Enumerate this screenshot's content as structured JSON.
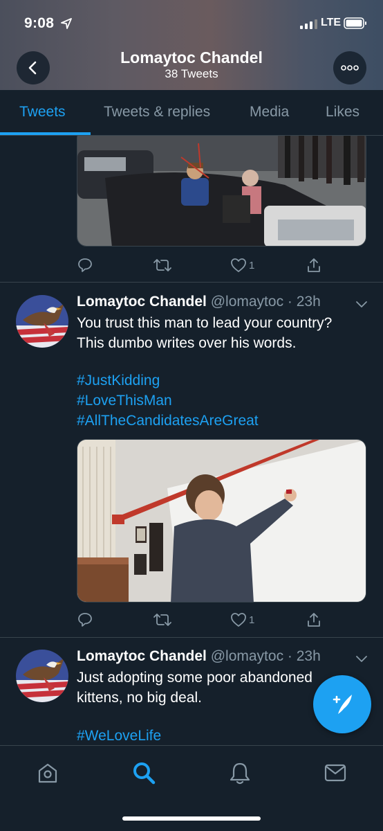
{
  "status_bar": {
    "time": "9:08",
    "network": "LTE"
  },
  "header": {
    "name": "Lomaytoc Chandel",
    "tweet_count": "38 Tweets"
  },
  "tabs": [
    {
      "label": "Tweets",
      "active": true
    },
    {
      "label": "Tweets & replies",
      "active": false
    },
    {
      "label": "Media",
      "active": false
    },
    {
      "label": "Likes",
      "active": false
    }
  ],
  "tweets": [
    {
      "partial": true,
      "image": "motorcade-photo",
      "likes": "1"
    },
    {
      "name": "Lomaytoc Chandel",
      "handle": "@lomaytoc",
      "time": "· 23h",
      "text_lines": [
        "You trust this man to lead your country?",
        "This dumbo writes over his words."
      ],
      "hashtags": [
        "#JustKidding",
        "#LoveThisMan",
        "#AllTheCandidatesAreGreat"
      ],
      "image": "classroom-whiteboard-photo",
      "likes": "1"
    },
    {
      "name": "Lomaytoc Chandel",
      "handle": "@lomaytoc",
      "time": "· 23h",
      "text_lines": [
        "Just adopting some poor abandoned",
        "kittens, no big deal."
      ],
      "hashtags": [
        "#WeLoveLife"
      ]
    }
  ],
  "icons": {
    "reply": "reply-icon",
    "retweet": "retweet-icon",
    "like": "heart-icon",
    "share": "share-icon",
    "compose": "compose-tweet-icon",
    "home": "home-icon",
    "search": "search-icon",
    "notifications": "bell-icon",
    "messages": "mail-icon"
  },
  "colors": {
    "accent": "#1da1f2",
    "background": "#15202b",
    "muted": "#8899a6",
    "border": "#38444d"
  }
}
